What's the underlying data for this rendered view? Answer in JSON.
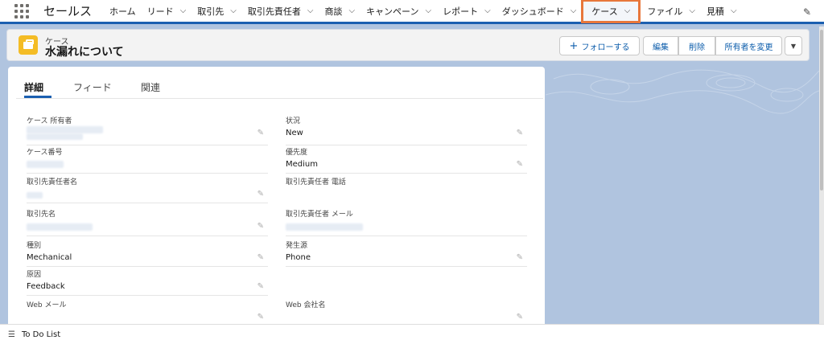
{
  "app": {
    "name": "セールス"
  },
  "nav": {
    "items": [
      {
        "label": "ホーム"
      },
      {
        "label": "リード"
      },
      {
        "label": "取引先"
      },
      {
        "label": "取引先責任者"
      },
      {
        "label": "商談"
      },
      {
        "label": "キャンペーン"
      },
      {
        "label": "レポート"
      },
      {
        "label": "ダッシュボード"
      },
      {
        "label": "ケース"
      },
      {
        "label": "ファイル"
      },
      {
        "label": "見積"
      }
    ],
    "active": "ケース"
  },
  "record": {
    "object_label": "ケース",
    "title": "水漏れについて",
    "buttons": {
      "follow": "フォローする",
      "edit": "編集",
      "delete": "削除",
      "change_owner": "所有者を変更"
    }
  },
  "tabs": [
    {
      "label": "詳細"
    },
    {
      "label": "フィード"
    },
    {
      "label": "関連"
    }
  ],
  "fields": {
    "left": [
      {
        "label": "ケース 所有者",
        "value": ""
      },
      {
        "label": "ケース番号",
        "value": ""
      },
      {
        "label": "取引先責任者名",
        "value": ""
      },
      {
        "label": "取引先名",
        "value": ""
      },
      {
        "label": "種別",
        "value": "Mechanical"
      },
      {
        "label": "原因",
        "value": "Feedback"
      },
      {
        "label": "Web メール",
        "value": ""
      }
    ],
    "right": [
      {
        "label": "状況",
        "value": "New"
      },
      {
        "label": "優先度",
        "value": "Medium"
      },
      {
        "label": "取引先責任者 電話",
        "value": ""
      },
      {
        "label": "取引先責任者 メール",
        "value": ""
      },
      {
        "label": "発生源",
        "value": "Phone"
      },
      {
        "label": "Web 会社名",
        "value": ""
      }
    ]
  },
  "footer": {
    "todo": "To Do List"
  },
  "colors": {
    "active_highlight": "#e8773b",
    "brand": "#1b5fb0",
    "case_icon": "#f4bc25"
  }
}
